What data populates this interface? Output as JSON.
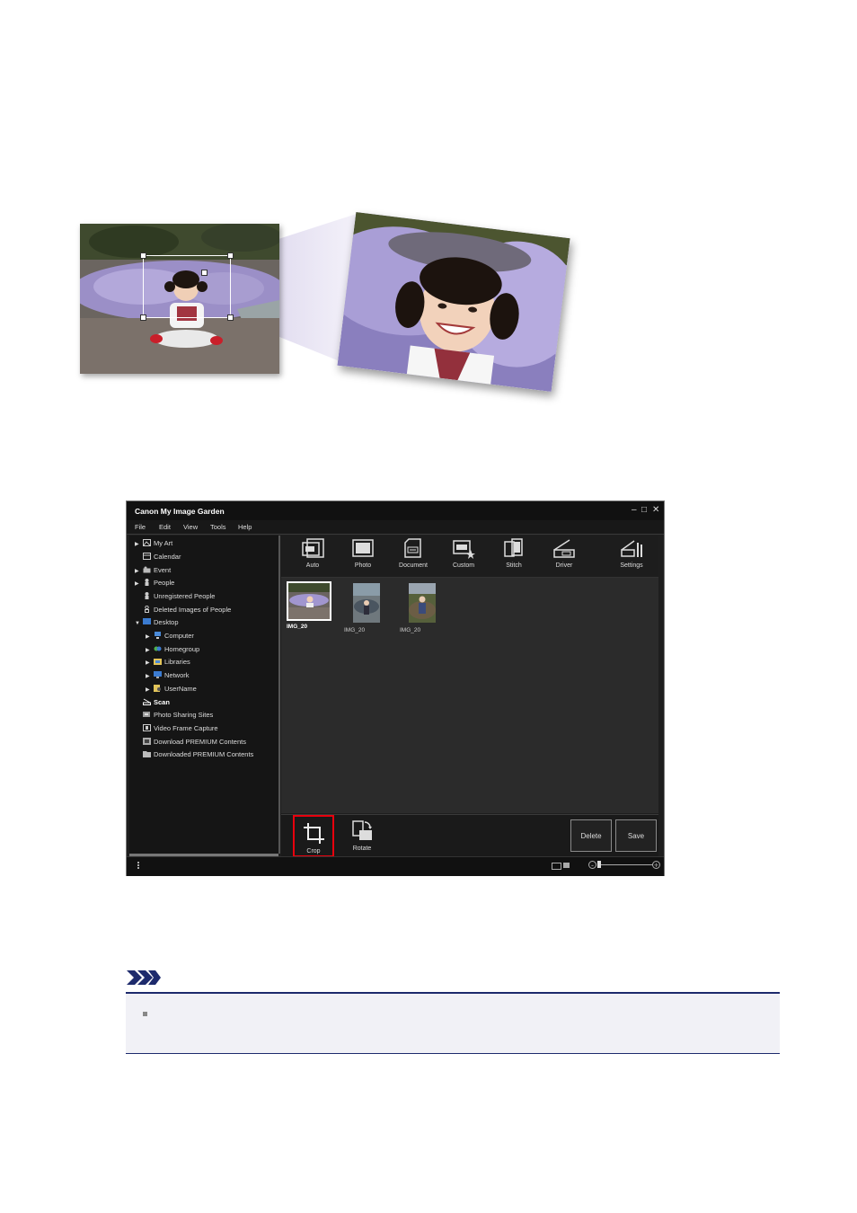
{
  "app": {
    "title": "Canon My Image Garden",
    "menu": [
      "File",
      "Edit",
      "View",
      "Tools",
      "Help"
    ]
  },
  "sidebar": {
    "items": [
      {
        "label": "My Art",
        "expander": true,
        "icon": "my-art-icon"
      },
      {
        "label": "Calendar",
        "expander": false,
        "icon": "calendar-icon"
      },
      {
        "label": "Event",
        "expander": true,
        "icon": "event-icon"
      },
      {
        "label": "People",
        "expander": true,
        "icon": "person-icon"
      },
      {
        "label": "Unregistered People",
        "expander": false,
        "icon": "person-icon"
      },
      {
        "label": "Deleted Images of People",
        "expander": false,
        "icon": "person-outline-icon"
      },
      {
        "label": "Desktop",
        "expander": true,
        "expanded": true,
        "icon": "desktop-icon"
      },
      {
        "label": "Computer",
        "expander": true,
        "indent": true,
        "icon": "computer-icon"
      },
      {
        "label": "Homegroup",
        "expander": true,
        "indent": true,
        "icon": "homegroup-icon"
      },
      {
        "label": "Libraries",
        "expander": true,
        "indent": true,
        "icon": "libraries-icon"
      },
      {
        "label": "Network",
        "expander": true,
        "indent": true,
        "icon": "network-icon"
      },
      {
        "label": "UserName",
        "expander": true,
        "indent": true,
        "icon": "user-folder-icon"
      },
      {
        "label": "Scan",
        "expander": false,
        "bold": true,
        "icon": "scan-icon"
      },
      {
        "label": "Photo Sharing Sites",
        "expander": false,
        "icon": "photo-sharing-icon"
      },
      {
        "label": "Video Frame Capture",
        "expander": false,
        "icon": "video-frame-icon"
      },
      {
        "label": "Download PREMIUM Contents",
        "expander": false,
        "icon": "download-icon"
      },
      {
        "label": "Downloaded PREMIUM Contents",
        "expander": false,
        "icon": "folder-icon"
      }
    ]
  },
  "toolbar": {
    "auto": "Auto",
    "photo": "Photo",
    "document": "Document",
    "custom": "Custom",
    "stitch": "Stitch",
    "driver": "Driver",
    "settings": "Settings"
  },
  "thumbnails": [
    {
      "caption": "IMG_20",
      "selected": true
    },
    {
      "caption": "IMG_20",
      "selected": false
    },
    {
      "caption": "IMG_20",
      "selected": false
    }
  ],
  "bottom": {
    "crop": "Crop",
    "rotate": "Rotate",
    "delete": "Delete",
    "save": "Save"
  },
  "colors": {
    "highlight": "#e8000d",
    "note_border": "#1d2a6c"
  }
}
